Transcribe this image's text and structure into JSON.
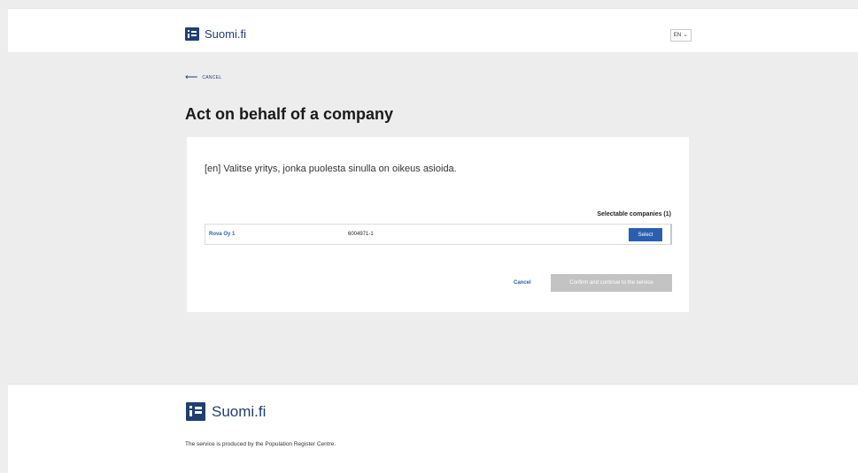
{
  "header": {
    "brand": "Suomi.fi",
    "language": "EN"
  },
  "main": {
    "back_label": "CANCEL",
    "title": "Act on behalf of a company",
    "intro": "[en] Valitse yritys, jonka puolesta sinulla on oikeus asioida.",
    "selectable_label": "Selectable companies (1)",
    "companies": [
      {
        "name": "Rova Oy 1",
        "business_id": "6004971-1",
        "select_label": "Select"
      }
    ],
    "cancel_label": "Cancel",
    "confirm_label": "Confirm and continue to the service"
  },
  "footer": {
    "brand": "Suomi.fi",
    "produced_by": "The service is produced by the Population Register Centre."
  },
  "colors": {
    "brand": "#1f3f73",
    "link": "#2a5fb0",
    "disabled": "#c3c3c3",
    "background": "#ededed"
  },
  "icons": {
    "logo": "suomi-fi-logo-icon",
    "back": "arrow-left-icon",
    "dropdown": "chevron-down-icon"
  }
}
